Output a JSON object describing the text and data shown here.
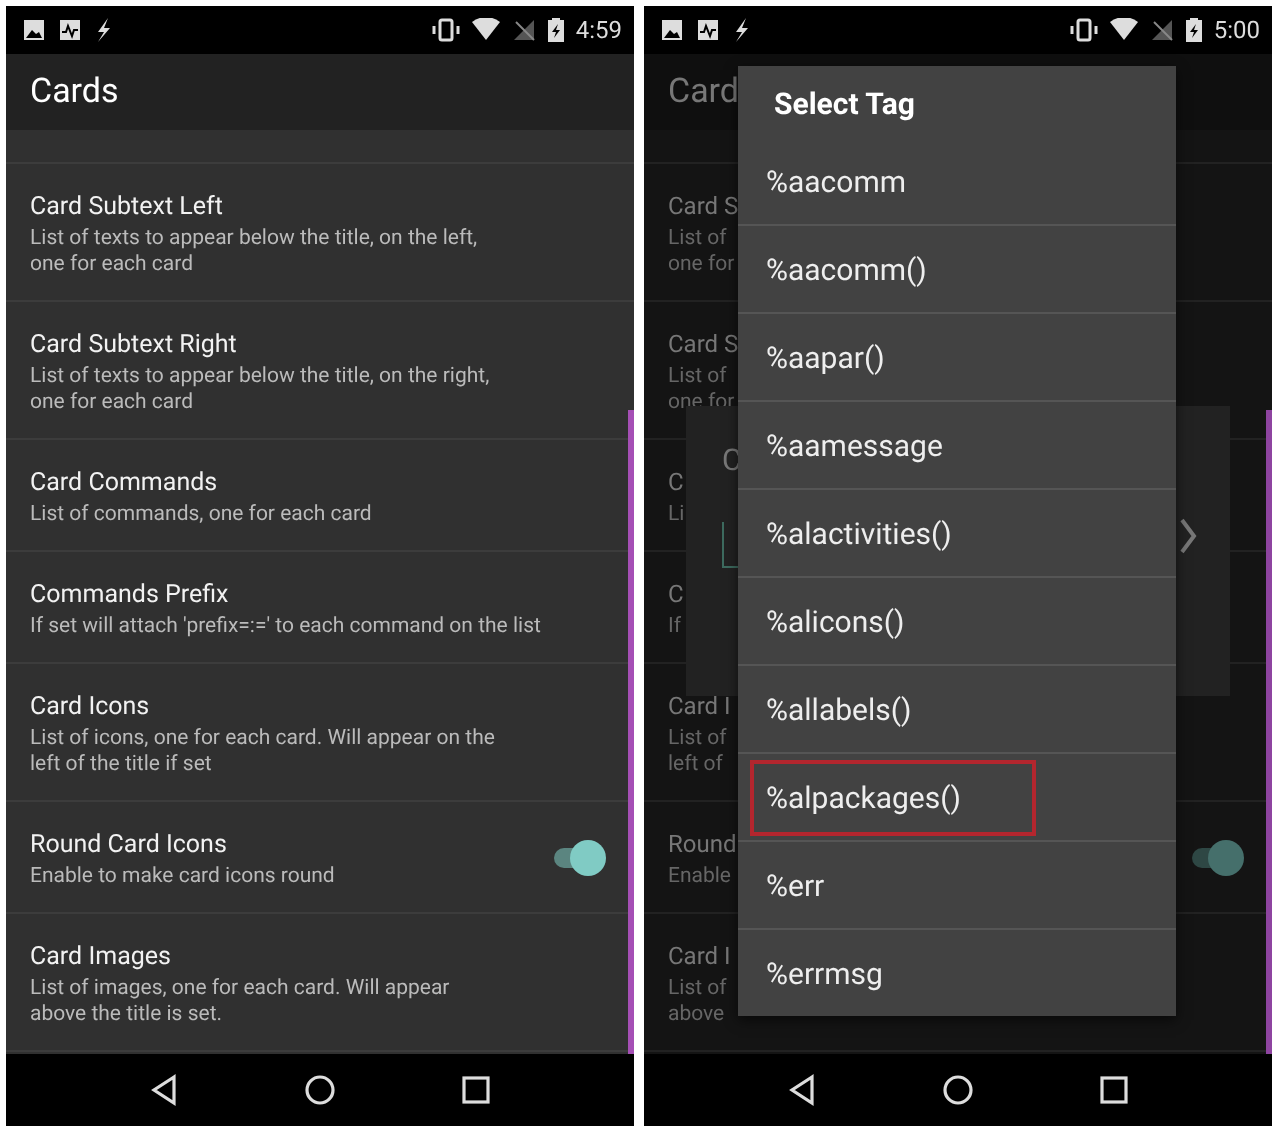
{
  "screens": [
    {
      "status_bar": {
        "time": "4:59"
      },
      "app_bar": {
        "title": "Cards"
      },
      "settings": [
        {
          "kind": "text",
          "title": "Card Subtext Left",
          "lines": [
            "List of texts to appear below the title, on the left,",
            "one for each card"
          ]
        },
        {
          "kind": "text",
          "title": "Card Subtext Right",
          "lines": [
            "List of texts to appear below the title, on the right,",
            "one for each card"
          ]
        },
        {
          "kind": "text",
          "title": "Card Commands",
          "lines": [
            "List of commands, one for each card"
          ]
        },
        {
          "kind": "text",
          "title": "Commands Prefix",
          "lines": [
            "If set will attach 'prefix=:=' to each command on the list"
          ]
        },
        {
          "kind": "text",
          "title": "Card Icons",
          "lines": [
            "List of icons, one for each card. Will appear on the",
            "left of the title if set"
          ]
        },
        {
          "kind": "switch",
          "title": "Round Card Icons",
          "lines": [
            "Enable to make card icons round"
          ],
          "on": true
        },
        {
          "kind": "text",
          "title": "Card Images",
          "lines": [
            "List of images, one for each card. Will appear",
            "above the title is set."
          ]
        }
      ]
    },
    {
      "status_bar": {
        "time": "5:00"
      },
      "app_bar": {
        "title": "Card"
      },
      "settings": [
        {
          "kind": "text",
          "title": "Card S",
          "lines": [
            "List of",
            "one for"
          ]
        },
        {
          "kind": "text",
          "title": "Card S",
          "lines": [
            "List of",
            "one for"
          ]
        },
        {
          "kind": "text",
          "title": "C",
          "lines": [
            "Li"
          ]
        },
        {
          "kind": "text",
          "title": "C",
          "lines": [
            "If"
          ]
        },
        {
          "kind": "text",
          "title": "Card I",
          "lines": [
            "List of",
            "left of"
          ]
        },
        {
          "kind": "switch",
          "title": "Round",
          "lines": [
            "Enable"
          ],
          "on": true
        },
        {
          "kind": "text",
          "title": "Card I",
          "lines": [
            "List of",
            "above"
          ]
        }
      ],
      "dialog": {
        "title": "C"
      },
      "menu": {
        "title": "Select Tag",
        "items": [
          {
            "label": "%aacomm",
            "highlighted": false
          },
          {
            "label": "%aacomm()",
            "highlighted": false
          },
          {
            "label": "%aapar()",
            "highlighted": false
          },
          {
            "label": "%aamessage",
            "highlighted": false
          },
          {
            "label": "%alactivities()",
            "highlighted": false
          },
          {
            "label": "%alicons()",
            "highlighted": false
          },
          {
            "label": "%allabels()",
            "highlighted": false
          },
          {
            "label": "%alpackages()",
            "highlighted": true
          },
          {
            "label": "%err",
            "highlighted": false
          },
          {
            "label": "%errmsg",
            "highlighted": false
          }
        ]
      }
    }
  ]
}
